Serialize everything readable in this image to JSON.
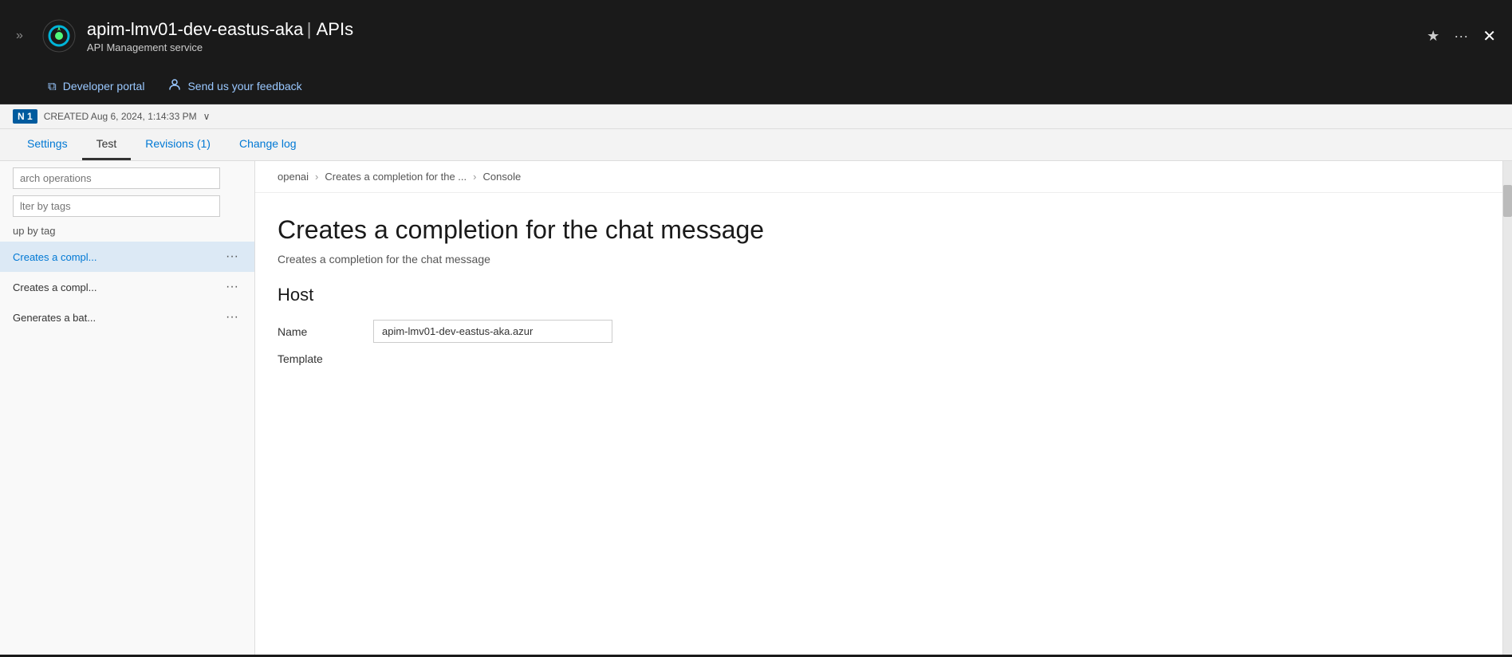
{
  "header": {
    "title": "apim-lmv01-dev-eastus-aka",
    "separator": "|",
    "service": "APIs",
    "subtitle": "API Management service",
    "star_icon": "★",
    "more_icon": "···",
    "close_icon": "✕"
  },
  "toolbar": {
    "expand_icon": "»",
    "developer_portal_label": "Developer portal",
    "feedback_label": "Send us your feedback",
    "portal_icon": "⧉",
    "feedback_icon": "👤"
  },
  "status_bar": {
    "revision_badge": "N 1",
    "created_text": "CREATED Aug 6, 2024, 1:14:33 PM",
    "dropdown_arrow": "∨"
  },
  "tabs": [
    {
      "id": "settings",
      "label": "Settings",
      "active": false
    },
    {
      "id": "test",
      "label": "Test",
      "active": true
    },
    {
      "id": "revisions",
      "label": "Revisions (1)",
      "active": false
    },
    {
      "id": "changelog",
      "label": "Change log",
      "active": false
    }
  ],
  "sidebar": {
    "search_placeholder": "arch operations",
    "filter_placeholder": "lter by tags",
    "group_label": "up by tag",
    "items": [
      {
        "id": "item1",
        "label": "Creates a compl...",
        "active": true
      },
      {
        "id": "item2",
        "label": "Creates a compl...",
        "active": false
      },
      {
        "id": "item3",
        "label": "Generates a bat...",
        "active": false
      }
    ],
    "ellipsis": "···"
  },
  "breadcrumb": {
    "parts": [
      "openai",
      "Creates a completion for the ...",
      "Console"
    ],
    "separator": ">"
  },
  "main": {
    "api_title": "Creates a completion for the chat message",
    "api_desc": "Creates a completion for the chat message",
    "host_section": "Host",
    "fields": [
      {
        "label": "Name",
        "value": "apim-lmv01-dev-eastus-aka.azur"
      },
      {
        "label": "Template",
        "value": ""
      }
    ]
  },
  "colors": {
    "accent_blue": "#0078d4",
    "tab_active_border": "#333333",
    "topbar_bg": "#1a1a1a",
    "sidebar_active_bg": "#dce9f5"
  }
}
